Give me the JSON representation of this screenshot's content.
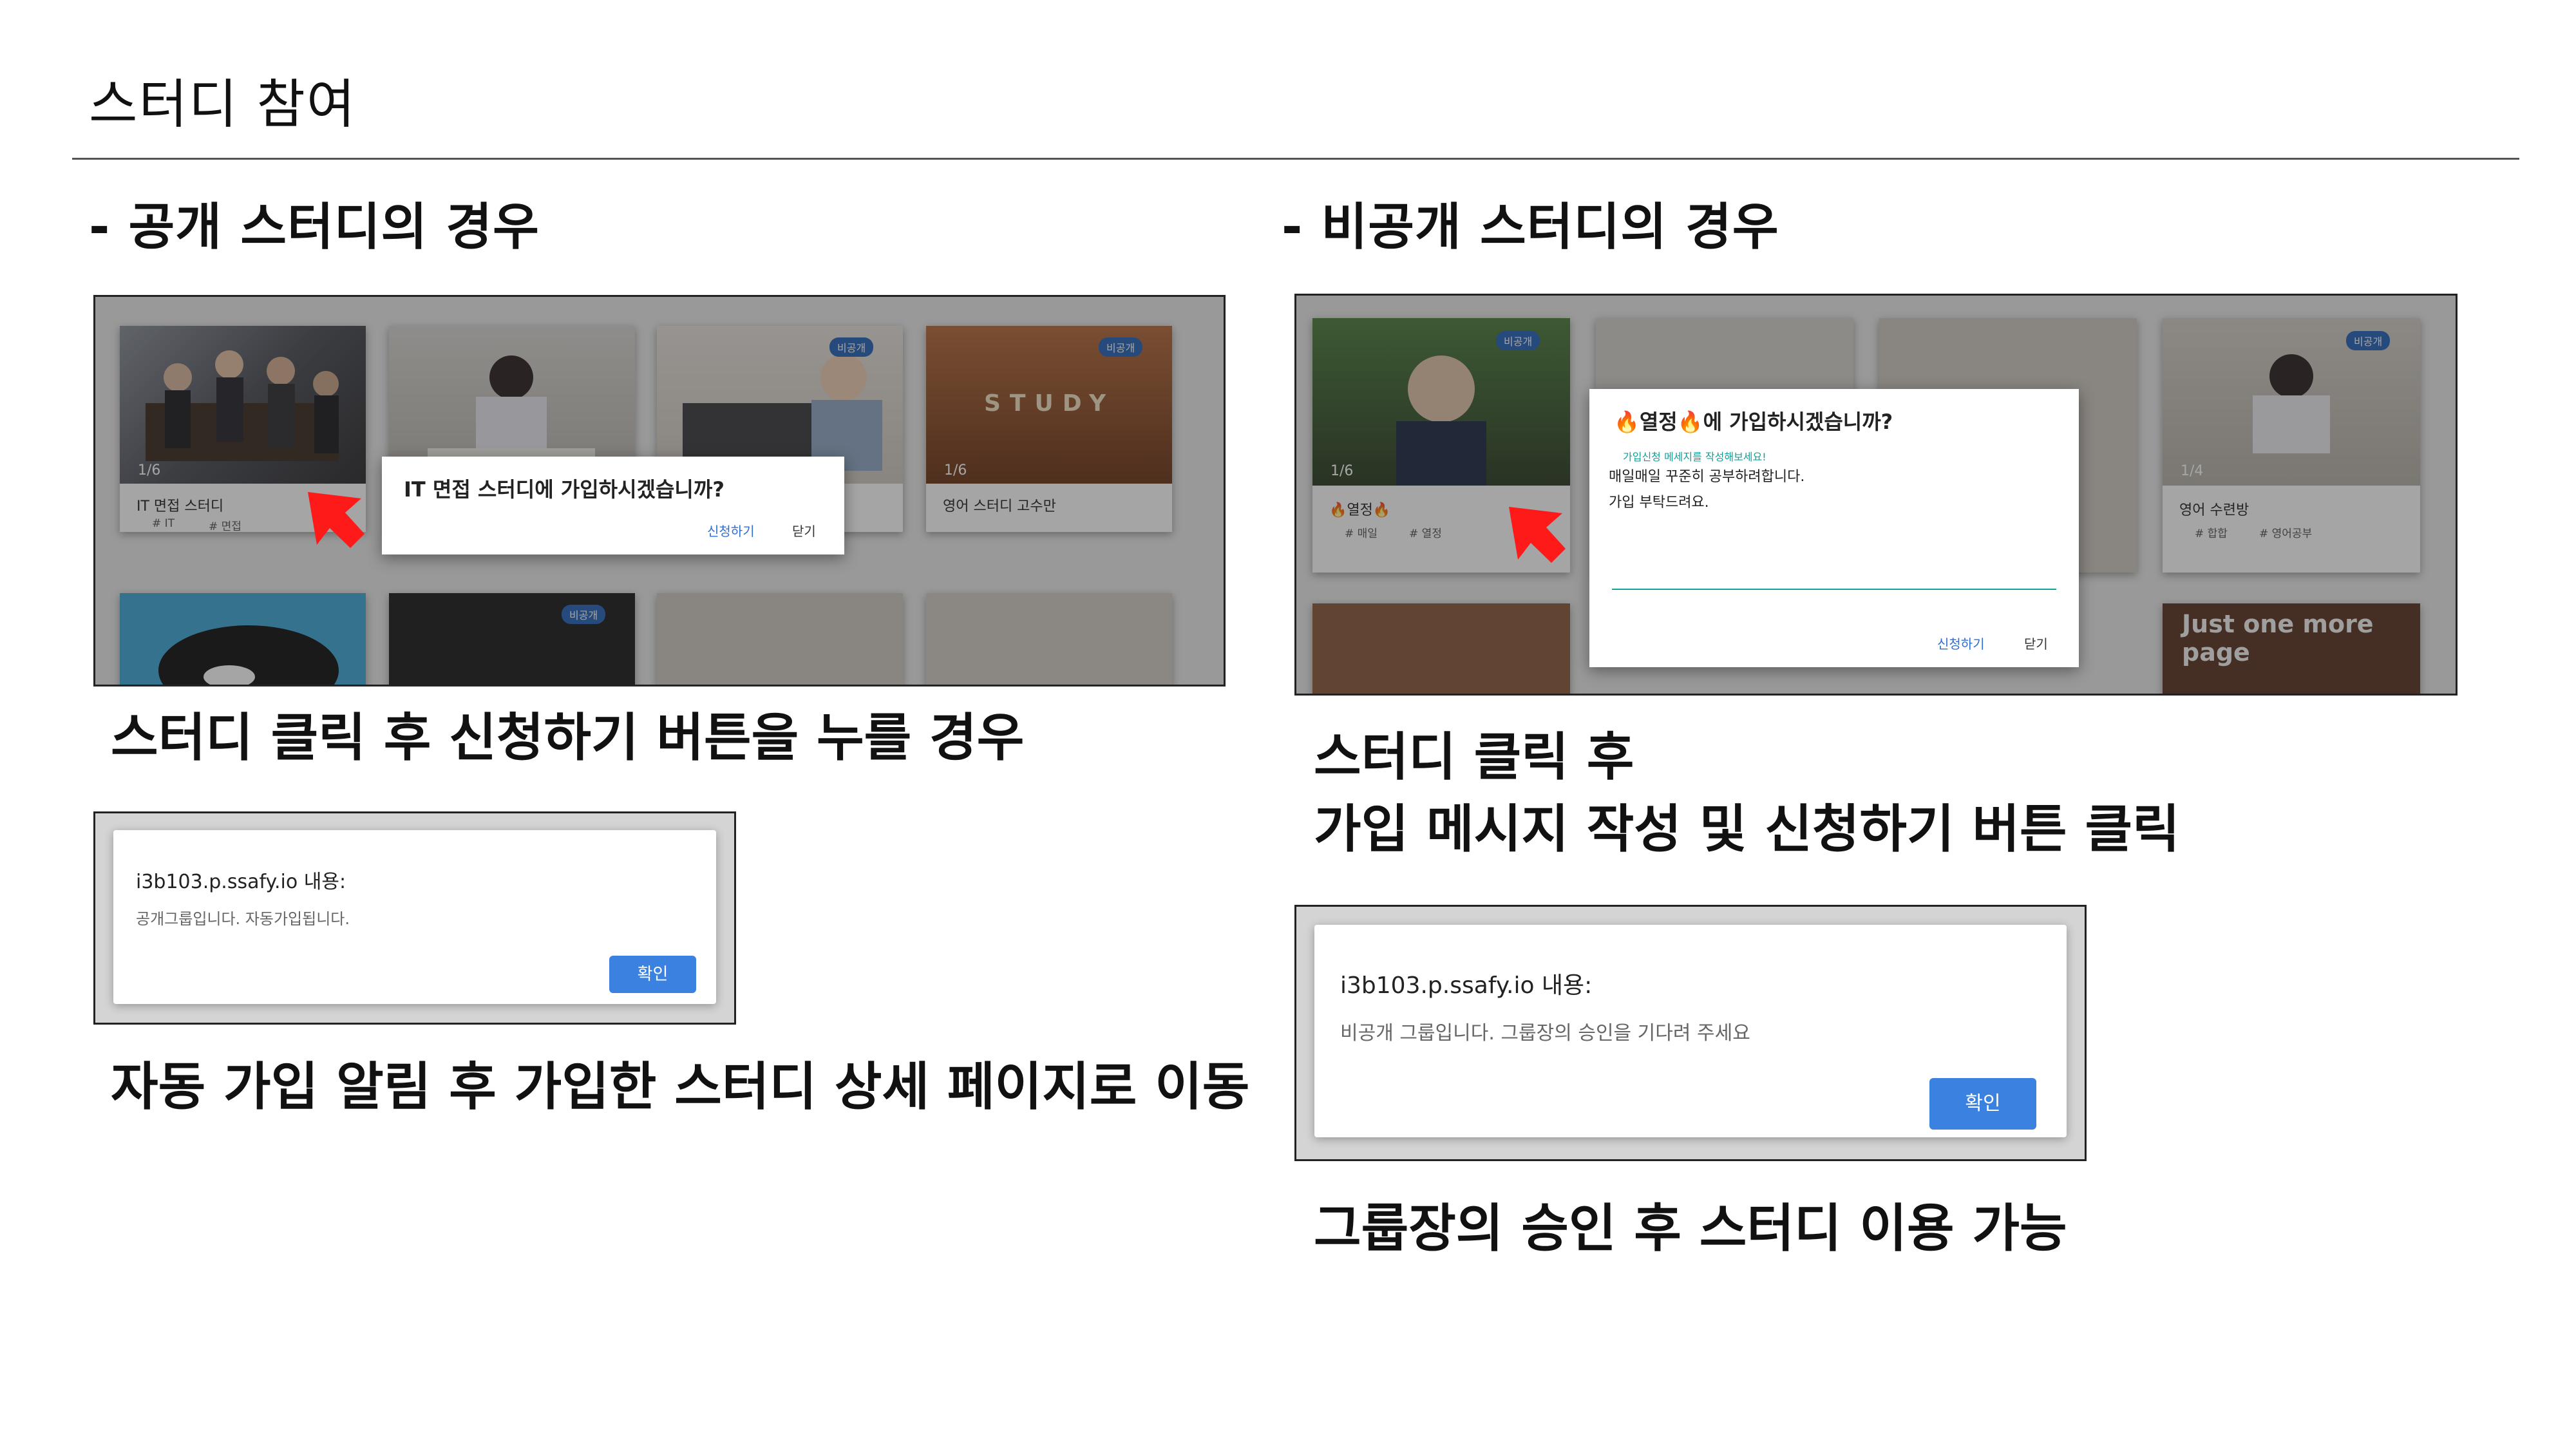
{
  "page": {
    "title": "스터디 참여"
  },
  "left": {
    "heading": "- 공개 스터디의 경우",
    "screen": {
      "cards_top": [
        {
          "title": "IT 면접 스터디",
          "tags": [
            "# IT",
            "# 면접"
          ],
          "members": "1/6"
        },
        {
          "title": "",
          "tags": []
        },
        {
          "title": "",
          "tags": [],
          "badge": "비공개"
        },
        {
          "title": "영어 스터디 고수만",
          "tags": [],
          "members": "1/6",
          "badge": "비공개",
          "thumb_text": "STUDY"
        }
      ],
      "bottom_badge": "비공개",
      "dialog": {
        "title": "IT 면접 스터디에 가입하시겠습니까?",
        "apply": "신청하기",
        "close": "닫기"
      }
    },
    "caption1": "스터디 클릭 후 신청하기 버튼을 누를 경우",
    "alert": {
      "origin": "i3b103.p.ssafy.io 내용:",
      "message": "공개그룹입니다. 자동가입됩니다.",
      "ok": "확인"
    },
    "caption2": "자동 가입 알림 후 가입한 스터디 상세 페이지로 이동"
  },
  "right": {
    "heading": "- 비공개 스터디의 경우",
    "screen": {
      "cards_top": [
        {
          "title": "🔥열정🔥",
          "tags": [
            "# 매일",
            "# 열정"
          ],
          "members": "1/6",
          "badge": "비공개"
        },
        {
          "title": "영어 수련방",
          "tags": [
            "# 합합",
            "# 영어공부"
          ],
          "members": "1/4",
          "badge": "비공개"
        }
      ],
      "bottom_text": "Just one more page",
      "dialog": {
        "title": "🔥열정🔥에 가입하시겠습니까?",
        "hint": "가입신청 메세지를 작성해보세요!",
        "line1": "매일매일 꾸준히 공부하려합니다.",
        "line2": "가입 부탁드려요.",
        "apply": "신청하기",
        "close": "닫기"
      }
    },
    "caption1_line1": "스터디 클릭 후",
    "caption1_line2": "가입 메시지 작성 및 신청하기 버튼 클릭",
    "alert": {
      "origin": "i3b103.p.ssafy.io 내용:",
      "message": "비공개 그룹입니다. 그룹장의 승인을 기다려 주세요",
      "ok": "확인"
    },
    "caption2": "그룹장의 승인 후 스터디 이용 가능"
  },
  "colors": {
    "link_blue": "#2f6fd3",
    "ok_button": "#3b82e0",
    "badge_blue": "#2563b8",
    "arrow_red": "#ff1a1a",
    "teal_hint": "#14a09a"
  }
}
